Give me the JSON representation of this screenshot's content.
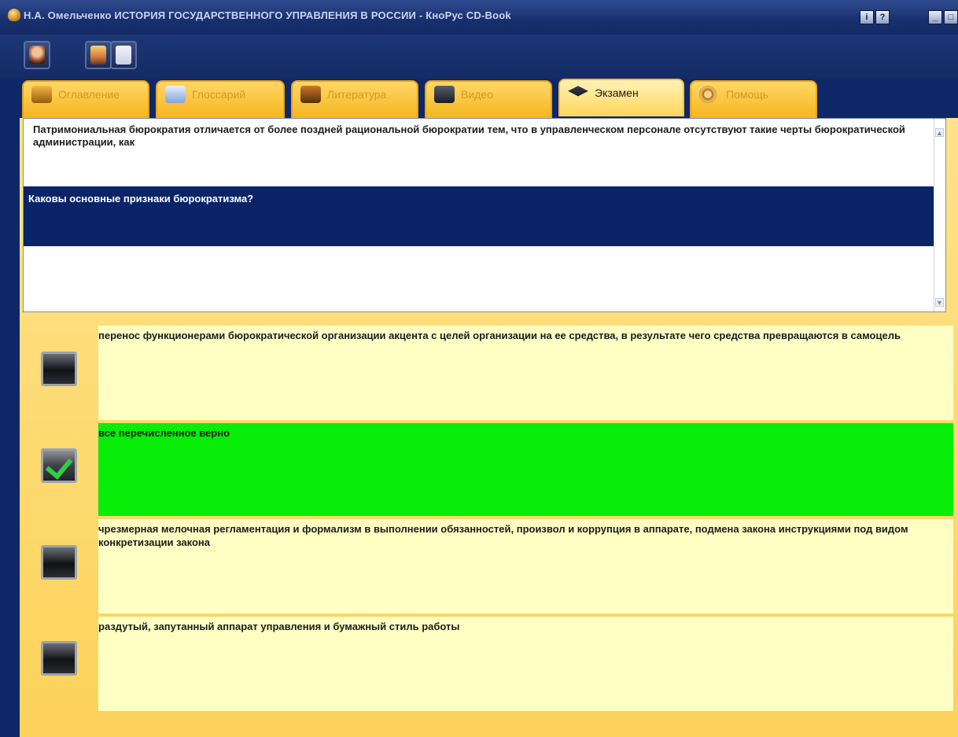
{
  "window": {
    "title": "Н.А. Омельченко ИСТОРИЯ ГОСУДАРСТВЕННОГО УПРАВЛЕНИЯ В РОССИИ - КноРус CD-Book",
    "buttons": [
      {
        "name": "info-button",
        "glyph": "i"
      },
      {
        "name": "help-button",
        "glyph": "?"
      },
      {
        "name": "minimize-button",
        "glyph": "_"
      },
      {
        "name": "maximize-button",
        "glyph": "□"
      }
    ]
  },
  "toolbar": {
    "buttons": [
      {
        "name": "author-icon",
        "color": "#a0583a"
      },
      {
        "name": "bookmark-icon",
        "color": "#d67a3b"
      },
      {
        "name": "page-icon",
        "color": "#c9d2e4"
      }
    ]
  },
  "tabs": [
    {
      "label": "Оглавление",
      "icon": "book-icon",
      "active": false
    },
    {
      "label": "Глоссарий",
      "icon": "glossary-icon",
      "active": false
    },
    {
      "label": "Литература",
      "icon": "books-icon",
      "active": false
    },
    {
      "label": "Видео",
      "icon": "video-icon",
      "active": false
    },
    {
      "label": "Экзамен",
      "icon": "graduation-cap-icon",
      "active": true
    },
    {
      "label": "Помощь",
      "icon": "lifebuoy-icon",
      "active": false
    }
  ],
  "exam": {
    "context": "Патримониальная бюрократия отличается от более поздней рациональной бюрократии тем, что в управленческом персонале отсутствуют такие черты бюрократической администрации, как",
    "question": "Каковы основные признаки бюрократизма?",
    "answers": [
      {
        "text": "перенос функционерами бюрократической организации акцента с целей организации на ее средства, в результате чего средства превращаются в самоцель",
        "checked": false
      },
      {
        "text": "все перечисленное верно",
        "checked": true
      },
      {
        "text": "чрезмерная мелочная регламентация и формализм в выполнении обязанностей, произвол и коррупция в аппарате, подмена закона инструкциями под видом конкретизации закона",
        "checked": false
      },
      {
        "text": "раздутый, запутанный аппарат управления и бумажный стиль работы",
        "checked": false
      }
    ]
  },
  "colors": {
    "selected_answer": "#08ee08",
    "answer_bg": "#ffffc4",
    "question_bar": "#0b2468",
    "panel": "#fcd25a"
  }
}
